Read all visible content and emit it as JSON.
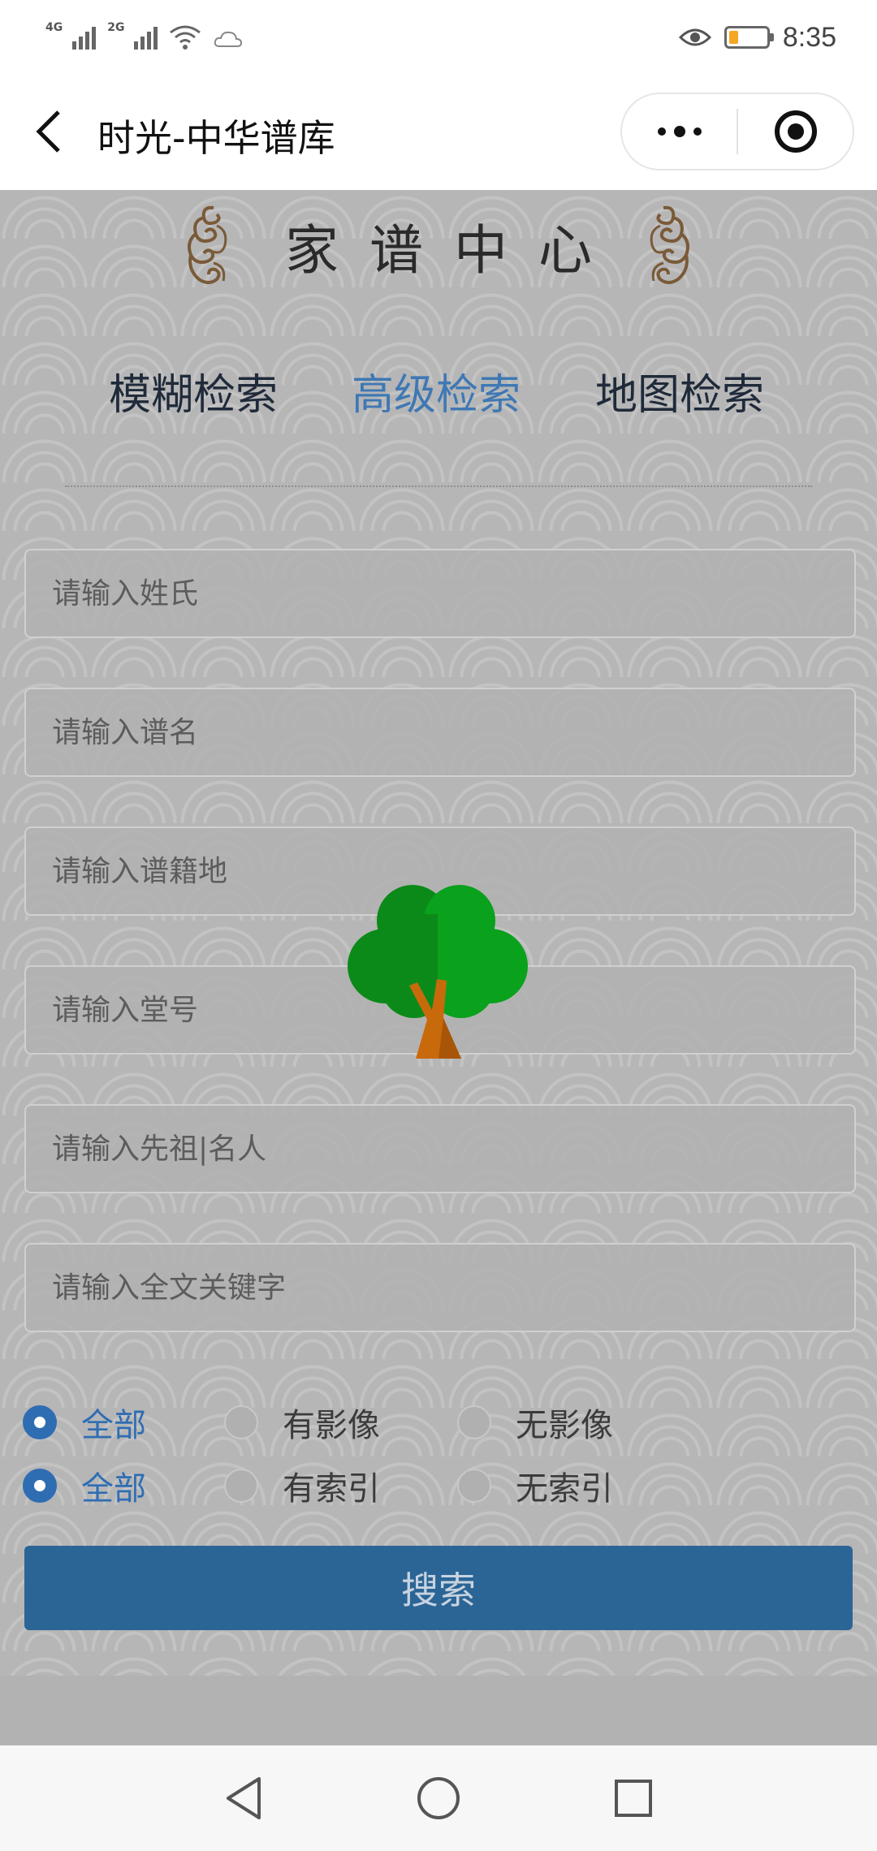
{
  "status_bar": {
    "network_1": "4G",
    "network_2": "2G",
    "time": "8:35",
    "battery_level": 0.15,
    "icons": [
      "signal-icon",
      "signal-icon",
      "wifi-icon",
      "weather-icon",
      "eye-icon",
      "battery-icon"
    ]
  },
  "nav": {
    "title": "时光-中华谱库",
    "back_icon": "chevron-left-icon",
    "more_icon": "more-dots-icon",
    "close_icon": "target-close-icon"
  },
  "heading": {
    "title": "家谱中心",
    "ornament_icon": "cloud-ornament-icon"
  },
  "tabs": [
    {
      "label": "模糊检索",
      "active": false
    },
    {
      "label": "高级检索",
      "active": true
    },
    {
      "label": "地图检索",
      "active": false
    }
  ],
  "fields": [
    {
      "placeholder": "请输入姓氏",
      "value": ""
    },
    {
      "placeholder": "请输入谱名",
      "value": ""
    },
    {
      "placeholder": "请输入谱籍地",
      "value": ""
    },
    {
      "placeholder": "请输入堂号",
      "value": ""
    },
    {
      "placeholder": "请输入先祖|名人",
      "value": ""
    },
    {
      "placeholder": "请输入全文关键字",
      "value": ""
    }
  ],
  "overlay_icon": "tree-icon",
  "filters": {
    "image": [
      {
        "label": "全部",
        "checked": true
      },
      {
        "label": "有影像",
        "checked": false
      },
      {
        "label": "无影像",
        "checked": false
      }
    ],
    "index": [
      {
        "label": "全部",
        "checked": true
      },
      {
        "label": "有索引",
        "checked": false
      },
      {
        "label": "无索引",
        "checked": false
      }
    ]
  },
  "search_button": {
    "label": "搜索"
  },
  "colors": {
    "accent": "#3f78b4",
    "button": "#2b6596",
    "background": "#b6b6b6"
  },
  "system_nav": [
    "back-triangle-icon",
    "home-circle-icon",
    "recent-square-icon"
  ]
}
